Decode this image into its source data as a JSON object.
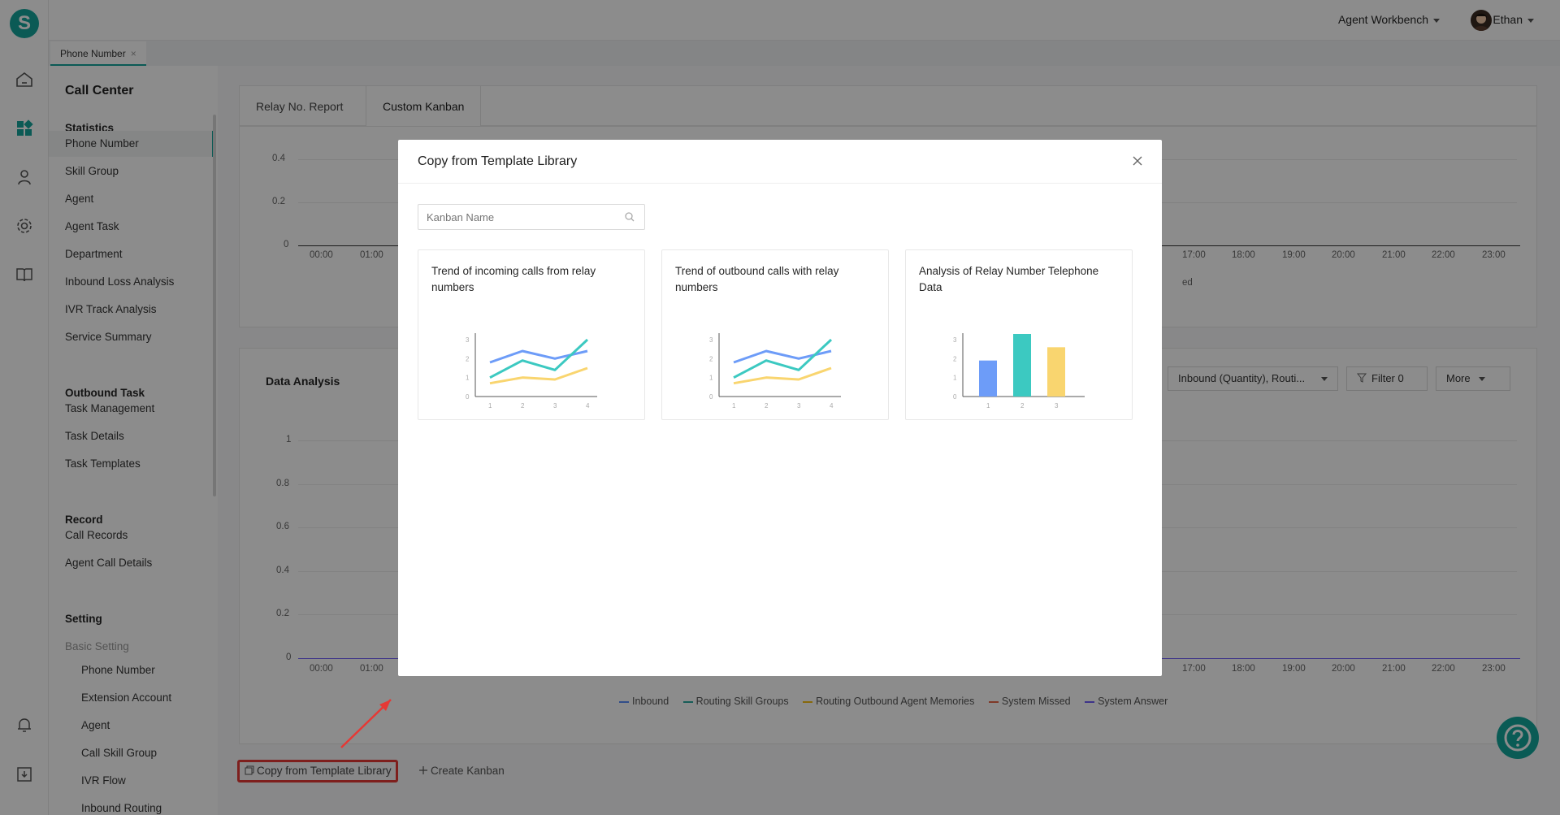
{
  "app": {
    "logo_letter": "S",
    "agent_workbench": "Agent Workbench",
    "user_name": "Ethan"
  },
  "page_tab": {
    "label": "Phone Number",
    "close": "×"
  },
  "menu": {
    "title": "Call Center",
    "statistics": {
      "heading": "Statistics",
      "items": [
        "Phone Number",
        "Skill Group",
        "Agent",
        "Agent Task",
        "Department",
        "Inbound Loss Analysis",
        "IVR Track Analysis",
        "Service Summary"
      ]
    },
    "outbound": {
      "heading": "Outbound Task",
      "items": [
        "Task Management",
        "Task Details",
        "Task Templates"
      ]
    },
    "record": {
      "heading": "Record",
      "items": [
        "Call Records",
        "Agent Call Details"
      ]
    },
    "setting": {
      "heading": "Setting",
      "sub_heading": "Basic Setting",
      "items": [
        "Phone Number",
        "Extension Account",
        "Agent",
        "Call Skill Group",
        "IVR Flow",
        "Inbound Routing"
      ]
    }
  },
  "content_tabs": [
    "Relay No. Report",
    "Custom Kanban"
  ],
  "top_chart": {
    "y_ticks": [
      "0.4",
      "0.2",
      "0"
    ],
    "x_ticks_left": [
      "00:00",
      "01:00"
    ],
    "x_ticks_right": [
      "17:00",
      "18:00",
      "19:00",
      "20:00",
      "21:00",
      "22:00",
      "23:00"
    ],
    "partial_text": "ed"
  },
  "data_analysis": {
    "title": "Data Analysis",
    "series_select": "Inbound (Quantity), Routi...",
    "filter_label": "Filter 0",
    "more_label": "More",
    "y_ticks": [
      "1",
      "0.8",
      "0.6",
      "0.4",
      "0.2",
      "0"
    ],
    "x_ticks_left": [
      "00:00",
      "01:00"
    ],
    "x_ticks_right": [
      "17:00",
      "18:00",
      "19:00",
      "20:00",
      "21:00",
      "22:00",
      "23:00"
    ],
    "legend": [
      {
        "name": "Inbound",
        "color": "#5b8ff9"
      },
      {
        "name": "Routing Skill Groups",
        "color": "#2aa9a0"
      },
      {
        "name": "Routing Outbound Agent Memories",
        "color": "#f6bd16"
      },
      {
        "name": "System Missed",
        "color": "#e8684a"
      },
      {
        "name": "System Answer",
        "color": "#6f5ef9"
      }
    ]
  },
  "bottom": {
    "copy_label": "Copy from Template Library",
    "create_label": "Create Kanban"
  },
  "modal": {
    "title": "Copy from Template Library",
    "search_placeholder": "Kanban Name",
    "templates": [
      {
        "title": "Trend of incoming calls from relay numbers",
        "type": "line"
      },
      {
        "title": "Trend of outbound calls with relay numbers",
        "type": "line"
      },
      {
        "title": "Analysis of Relay Number Telephone Data",
        "type": "bar"
      }
    ]
  },
  "chart_data": [
    {
      "type": "line",
      "title": "",
      "x": [
        1,
        2,
        3,
        4
      ],
      "ylim": [
        0,
        3
      ],
      "series": [
        {
          "values": [
            1.8,
            2.4,
            2.0,
            2.4
          ]
        },
        {
          "values": [
            1.0,
            1.9,
            1.4,
            3.0
          ]
        },
        {
          "values": [
            0.7,
            1.0,
            0.9,
            1.5
          ]
        }
      ]
    },
    {
      "type": "line",
      "title": "",
      "x": [
        1,
        2,
        3,
        4
      ],
      "ylim": [
        0,
        3
      ],
      "series": [
        {
          "values": [
            1.8,
            2.4,
            2.0,
            2.4
          ]
        },
        {
          "values": [
            1.0,
            1.9,
            1.4,
            3.0
          ]
        },
        {
          "values": [
            0.7,
            1.0,
            0.9,
            1.5
          ]
        }
      ]
    },
    {
      "type": "bar",
      "title": "",
      "categories": [
        "1",
        "2",
        "3"
      ],
      "values": [
        1.9,
        3.3,
        2.6
      ],
      "ylim": [
        0,
        3
      ]
    }
  ],
  "colors": {
    "brand": "#14a59b",
    "blue": "#6d9cf8",
    "teal": "#3cc9c1",
    "yellow": "#f9d56f",
    "highlight": "#e53935"
  }
}
